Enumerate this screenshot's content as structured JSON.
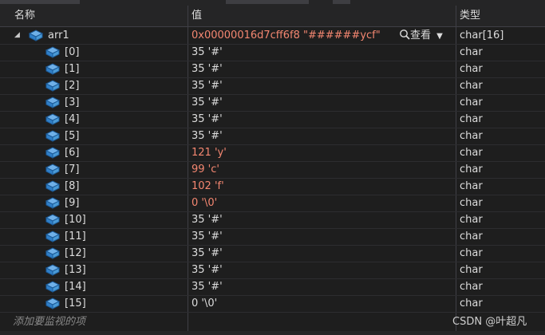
{
  "header": {
    "col_name": "名称",
    "col_value": "值",
    "col_type": "类型"
  },
  "root": {
    "name": "arr1",
    "value": "0x00000016d7cff6f8 \"######ycf\"",
    "view_label": "查看",
    "type": "char[16]"
  },
  "items": [
    {
      "name": "[0]",
      "value": "35 '#'",
      "type": "char",
      "changed": false
    },
    {
      "name": "[1]",
      "value": "35 '#'",
      "type": "char",
      "changed": false
    },
    {
      "name": "[2]",
      "value": "35 '#'",
      "type": "char",
      "changed": false
    },
    {
      "name": "[3]",
      "value": "35 '#'",
      "type": "char",
      "changed": false
    },
    {
      "name": "[4]",
      "value": "35 '#'",
      "type": "char",
      "changed": false
    },
    {
      "name": "[5]",
      "value": "35 '#'",
      "type": "char",
      "changed": false
    },
    {
      "name": "[6]",
      "value": "121 'y'",
      "type": "char",
      "changed": true
    },
    {
      "name": "[7]",
      "value": "99 'c'",
      "type": "char",
      "changed": true
    },
    {
      "name": "[8]",
      "value": "102 'f'",
      "type": "char",
      "changed": true
    },
    {
      "name": "[9]",
      "value": "0 '\\0'",
      "type": "char",
      "changed": true
    },
    {
      "name": "[10]",
      "value": "35 '#'",
      "type": "char",
      "changed": false
    },
    {
      "name": "[11]",
      "value": "35 '#'",
      "type": "char",
      "changed": false
    },
    {
      "name": "[12]",
      "value": "35 '#'",
      "type": "char",
      "changed": false
    },
    {
      "name": "[13]",
      "value": "35 '#'",
      "type": "char",
      "changed": false
    },
    {
      "name": "[14]",
      "value": "35 '#'",
      "type": "char",
      "changed": false
    },
    {
      "name": "[15]",
      "value": "0 '\\0'",
      "type": "char",
      "changed": false
    }
  ],
  "add_watch_placeholder": "添加要监视的项",
  "watermark": "CSDN @叶超凡",
  "colors": {
    "changed_value": "#f48771",
    "icon_blue": "#4a9ad6",
    "background": "#1e1e1e"
  }
}
